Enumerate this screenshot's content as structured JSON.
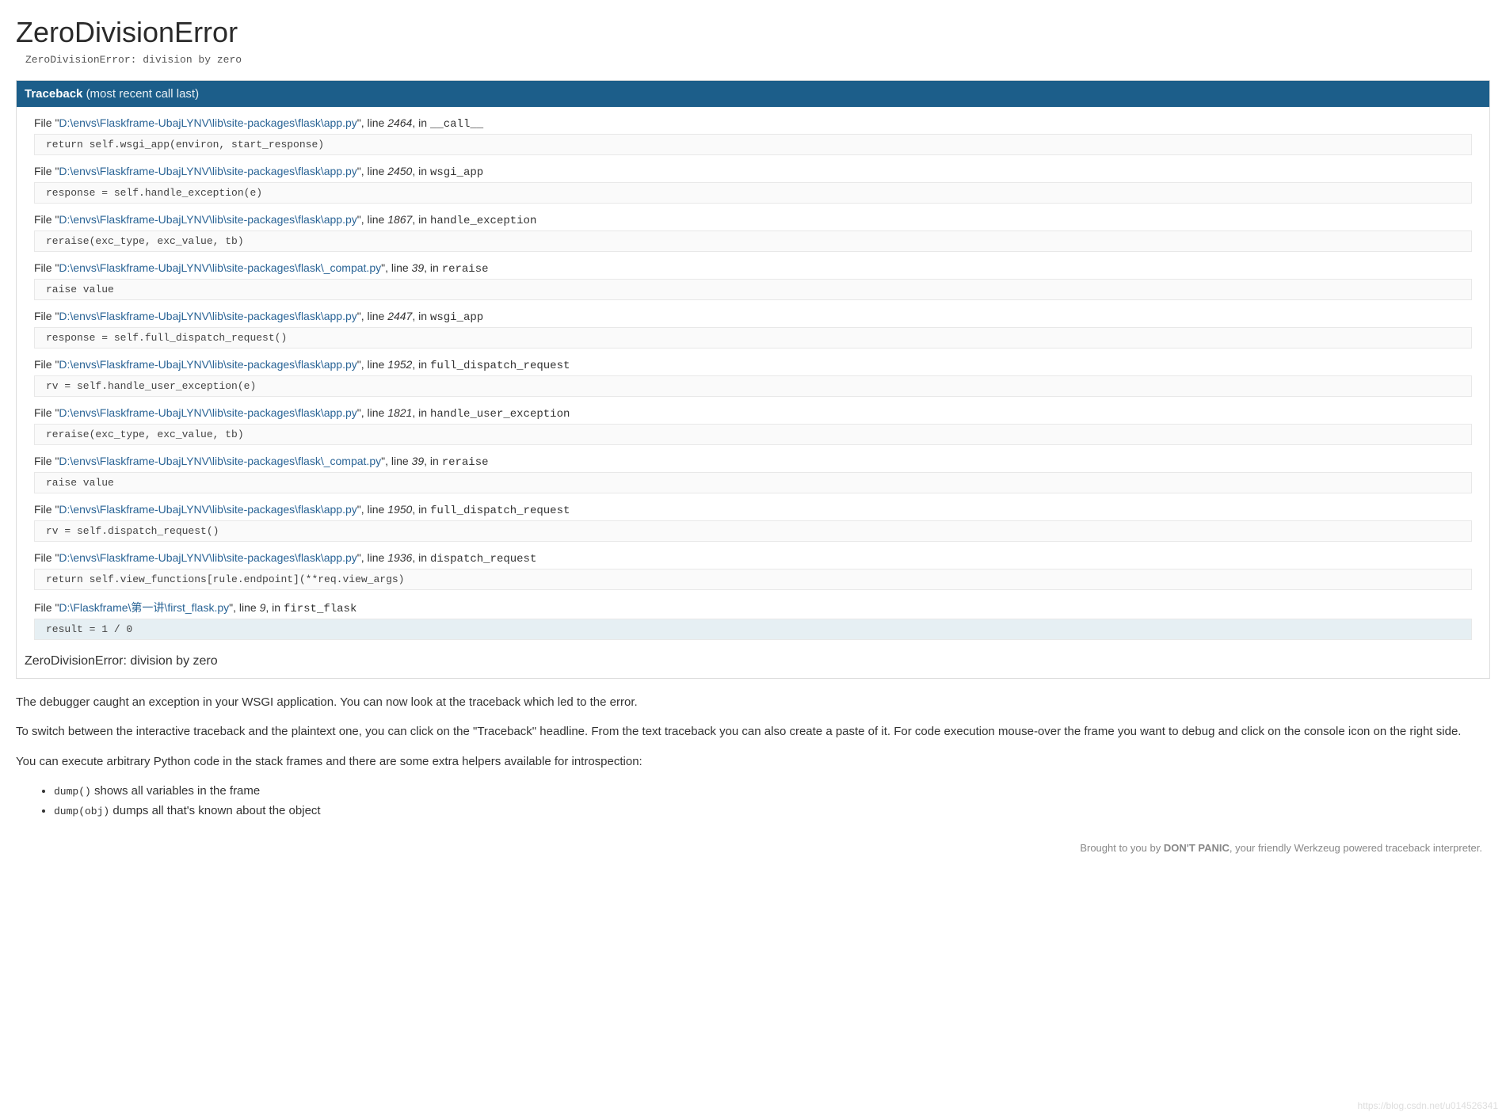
{
  "title": "ZeroDivisionError",
  "error_message": "ZeroDivisionError: division by zero",
  "traceback_header": {
    "label": "Traceback",
    "suffix": "(most recent call last)"
  },
  "frames": [
    {
      "path": "D:\\envs\\Flaskframe-UbajLYNV\\lib\\site-packages\\flask\\app.py",
      "line": "2464",
      "func": "__call__",
      "code": "return self.wsgi_app(environ, start_response)",
      "current": false
    },
    {
      "path": "D:\\envs\\Flaskframe-UbajLYNV\\lib\\site-packages\\flask\\app.py",
      "line": "2450",
      "func": "wsgi_app",
      "code": "response = self.handle_exception(e)",
      "current": false
    },
    {
      "path": "D:\\envs\\Flaskframe-UbajLYNV\\lib\\site-packages\\flask\\app.py",
      "line": "1867",
      "func": "handle_exception",
      "code": "reraise(exc_type, exc_value, tb)",
      "current": false
    },
    {
      "path": "D:\\envs\\Flaskframe-UbajLYNV\\lib\\site-packages\\flask\\_compat.py",
      "line": "39",
      "func": "reraise",
      "code": "raise value",
      "current": false
    },
    {
      "path": "D:\\envs\\Flaskframe-UbajLYNV\\lib\\site-packages\\flask\\app.py",
      "line": "2447",
      "func": "wsgi_app",
      "code": "response = self.full_dispatch_request()",
      "current": false
    },
    {
      "path": "D:\\envs\\Flaskframe-UbajLYNV\\lib\\site-packages\\flask\\app.py",
      "line": "1952",
      "func": "full_dispatch_request",
      "code": "rv = self.handle_user_exception(e)",
      "current": false
    },
    {
      "path": "D:\\envs\\Flaskframe-UbajLYNV\\lib\\site-packages\\flask\\app.py",
      "line": "1821",
      "func": "handle_user_exception",
      "code": "reraise(exc_type, exc_value, tb)",
      "current": false
    },
    {
      "path": "D:\\envs\\Flaskframe-UbajLYNV\\lib\\site-packages\\flask\\_compat.py",
      "line": "39",
      "func": "reraise",
      "code": "raise value",
      "current": false
    },
    {
      "path": "D:\\envs\\Flaskframe-UbajLYNV\\lib\\site-packages\\flask\\app.py",
      "line": "1950",
      "func": "full_dispatch_request",
      "code": "rv = self.dispatch_request()",
      "current": false
    },
    {
      "path": "D:\\envs\\Flaskframe-UbajLYNV\\lib\\site-packages\\flask\\app.py",
      "line": "1936",
      "func": "dispatch_request",
      "code": "return self.view_functions[rule.endpoint](**req.view_args)",
      "current": false
    },
    {
      "path": "D:\\Flaskframe\\第一讲\\first_flask.py",
      "line": "9",
      "func": "first_flask",
      "code": "result = 1 / 0",
      "current": true
    }
  ],
  "file_label_prefix": "File \"",
  "file_label_suffix": "\", line ",
  "func_prefix": ", in ",
  "exception_repeat": "ZeroDivisionError: division by zero",
  "info": {
    "p1": "The debugger caught an exception in your WSGI application. You can now look at the traceback which led to the error.",
    "p2": "To switch between the interactive traceback and the plaintext one, you can click on the \"Traceback\" headline. From the text traceback you can also create a paste of it. For code execution mouse-over the frame you want to debug and click on the console icon on the right side.",
    "p3": "You can execute arbitrary Python code in the stack frames and there are some extra helpers available for introspection:",
    "li1_code": "dump()",
    "li1_text": " shows all variables in the frame",
    "li2_code": "dump(obj)",
    "li2_text": " dumps all that's known about the object"
  },
  "footer": {
    "pre": "Brought to you by ",
    "strong": "DON'T PANIC",
    "post": ", your friendly Werkzeug powered traceback interpreter."
  },
  "watermark": "https://blog.csdn.net/u014526341"
}
